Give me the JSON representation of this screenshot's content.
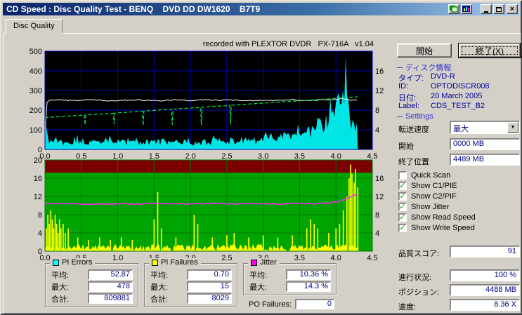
{
  "window": {
    "title": "CD Speed : Disc Quality Test - BENQ    DVD DD DW1620    B7T9"
  },
  "tab": {
    "label": "Disc Quality"
  },
  "chart_header": "recorded with PLEXTOR DVDR   PX-716A   v1.04",
  "chart_data": [
    {
      "id": "pi-errors-speed",
      "type": "area",
      "seed": 13,
      "bg": "#000000",
      "grid": "#0000BB",
      "x_range": [
        0,
        4.5
      ],
      "x_ticks": [
        "0.0",
        "0.5",
        "1.0",
        "1.5",
        "2.0",
        "2.5",
        "3.0",
        "3.5",
        "4.0",
        "4.5"
      ],
      "y_range": [
        0,
        500
      ],
      "left_ticks": [
        500,
        400,
        300,
        200,
        100,
        0
      ],
      "right_axis_range": [
        0,
        20
      ],
      "right_ticks": [
        16,
        12,
        8,
        4
      ],
      "grid_values": [
        100,
        200,
        300,
        400
      ],
      "series": [
        {
          "name": "PI Errors",
          "type": "noise-fill",
          "color": "#00E6E6",
          "x0": 0,
          "step": 0.05,
          "values": [
            170,
            60,
            45,
            70,
            50,
            40,
            55,
            45,
            60,
            50,
            45,
            55,
            40,
            50,
            45,
            55,
            40,
            45,
            50,
            40,
            45,
            50,
            40,
            45,
            40,
            50,
            45,
            40,
            45,
            40,
            50,
            45,
            40,
            45,
            40,
            45,
            40,
            45,
            40,
            45,
            40,
            45,
            50,
            40,
            45,
            40,
            45,
            50,
            45,
            40,
            45,
            50,
            45,
            50,
            55,
            50,
            55,
            60,
            55,
            60,
            65,
            60,
            70,
            65,
            75,
            70,
            80,
            85,
            90,
            85,
            95,
            100,
            110,
            105,
            120,
            130,
            140,
            160,
            200,
            260,
            360,
            478,
            430,
            300,
            190,
            140,
            120
          ]
        },
        {
          "name": "Read Speed",
          "type": "line",
          "color": "#FFFFFF",
          "noise": 2.5,
          "width": 1,
          "points": [
            [
              0,
              80
            ],
            [
              0.03,
              248
            ],
            [
              0.2,
              252
            ],
            [
              0.4,
              249
            ],
            [
              0.6,
              254
            ],
            [
              0.8,
              250
            ],
            [
              1,
              247
            ],
            [
              1.2,
              253
            ],
            [
              1.4,
              250
            ],
            [
              1.6,
              248
            ],
            [
              1.8,
              252
            ],
            [
              2,
              249
            ],
            [
              2.2,
              253
            ],
            [
              2.4,
              250
            ],
            [
              2.6,
              252
            ],
            [
              2.8,
              248
            ],
            [
              3,
              251
            ],
            [
              3.2,
              249
            ],
            [
              3.4,
              253
            ],
            [
              3.6,
              250
            ],
            [
              3.8,
              252
            ],
            [
              4,
              255
            ],
            [
              4.1,
              258
            ],
            [
              4.2,
              252
            ],
            [
              4.3,
              250
            ]
          ]
        },
        {
          "name": "Write Speed",
          "type": "dashed-line",
          "color": "#00DD44",
          "width": 1.3,
          "points": [
            [
              0,
              162
            ],
            [
              0.54,
              175
            ],
            [
              0.55,
              125
            ],
            [
              0.56,
              176
            ],
            [
              0.94,
              184
            ],
            [
              0.95,
              128
            ],
            [
              0.96,
              185
            ],
            [
              1.34,
              195
            ],
            [
              1.35,
              122
            ],
            [
              1.36,
              195
            ],
            [
              1.74,
              205
            ],
            [
              1.75,
              126
            ],
            [
              1.76,
              205
            ],
            [
              2.14,
              214
            ],
            [
              2.15,
              124
            ],
            [
              2.16,
              215
            ],
            [
              2.54,
              224
            ],
            [
              2.55,
              127
            ],
            [
              2.56,
              225
            ],
            [
              3,
              236
            ],
            [
              3.5,
              248
            ],
            [
              4,
              260
            ],
            [
              4.3,
              268
            ]
          ]
        }
      ]
    },
    {
      "id": "pif-jitter",
      "type": "spikes-line",
      "seed": 99,
      "bg": "#00A400",
      "grid": "#007800",
      "band": {
        "from": 17.2,
        "to": 20,
        "color": "#7A0000"
      },
      "x_range": [
        0,
        4.5
      ],
      "x_ticks": [
        "0.0",
        "0.5",
        "1.0",
        "1.5",
        "2.0",
        "2.5",
        "3.0",
        "3.5",
        "4.0",
        "4.5"
      ],
      "y_range": [
        0,
        20
      ],
      "left_ticks": [
        20,
        16,
        12,
        8,
        4,
        0
      ],
      "right_axis_range": [
        0,
        20
      ],
      "right_ticks": [
        16,
        12,
        8,
        4
      ],
      "grid_values": [
        4,
        8,
        12,
        16
      ],
      "series": [
        {
          "name": "PI Failures",
          "type": "spikes",
          "color": "#FFFF00",
          "baseline_max": 1.6,
          "max_x": 4.32,
          "spikes": [
            [
              0.02,
              5
            ],
            [
              0.04,
              8
            ],
            [
              0.06,
              6
            ],
            [
              0.08,
              9
            ],
            [
              0.1,
              7
            ],
            [
              0.12,
              5
            ],
            [
              0.14,
              8
            ],
            [
              0.16,
              6
            ],
            [
              0.18,
              4
            ],
            [
              0.2,
              7
            ],
            [
              0.22,
              5
            ],
            [
              0.25,
              6
            ],
            [
              0.28,
              4
            ],
            [
              0.32,
              5
            ],
            [
              0.45,
              3
            ],
            [
              0.6,
              2.5
            ],
            [
              0.75,
              3
            ],
            [
              0.9,
              2.5
            ],
            [
              1.05,
              3
            ],
            [
              1.2,
              2.5
            ],
            [
              1.5,
              7
            ],
            [
              1.55,
              13
            ],
            [
              1.6,
              5
            ],
            [
              1.8,
              3
            ],
            [
              2.05,
              8
            ],
            [
              2.1,
              6
            ],
            [
              2.3,
              3
            ],
            [
              2.5,
              3.5
            ],
            [
              2.6,
              4
            ],
            [
              2.8,
              3
            ],
            [
              3,
              3.5
            ],
            [
              3.2,
              3
            ],
            [
              3.4,
              3.5
            ],
            [
              3.6,
              5
            ],
            [
              3.65,
              7
            ],
            [
              3.7,
              6
            ],
            [
              3.75,
              5
            ],
            [
              3.9,
              4
            ],
            [
              4,
              5
            ],
            [
              4.05,
              6
            ],
            [
              4.1,
              9
            ],
            [
              4.15,
              12
            ],
            [
              4.18,
              16
            ],
            [
              4.2,
              19
            ],
            [
              4.22,
              17
            ],
            [
              4.25,
              15
            ],
            [
              4.27,
              18
            ],
            [
              4.3,
              14
            ]
          ]
        },
        {
          "name": "Jitter",
          "type": "noise-line",
          "color": "#FF22FF",
          "noise": 0.15,
          "width": 1.5,
          "points": [
            [
              0,
              10.6
            ],
            [
              0.1,
              10.4
            ],
            [
              0.3,
              10.5
            ],
            [
              0.5,
              10.3
            ],
            [
              0.7,
              10.4
            ],
            [
              0.9,
              10.3
            ],
            [
              1.1,
              10.4
            ],
            [
              1.3,
              10.3
            ],
            [
              1.5,
              10.5
            ],
            [
              1.7,
              10.4
            ],
            [
              1.9,
              10.3
            ],
            [
              2.1,
              10.4
            ],
            [
              2.3,
              10.5
            ],
            [
              2.5,
              10.4
            ],
            [
              2.7,
              10.3
            ],
            [
              2.9,
              10.4
            ],
            [
              3.1,
              10.3
            ],
            [
              3.3,
              10.4
            ],
            [
              3.5,
              10.5
            ],
            [
              3.7,
              10.4
            ],
            [
              3.9,
              10.5
            ],
            [
              4,
              10.8
            ],
            [
              4.1,
              11.2
            ],
            [
              4.2,
              11.8
            ],
            [
              4.25,
              12.2
            ],
            [
              4.3,
              12.4
            ]
          ]
        }
      ]
    }
  ],
  "stats": {
    "pi_errors": {
      "title": "PI Errors",
      "color": "#00FFFF",
      "rows": [
        {
          "label": "平均:",
          "value": "52.87"
        },
        {
          "label": "最大:",
          "value": "478"
        },
        {
          "label": "合計:",
          "value": "809881"
        }
      ]
    },
    "pi_failures": {
      "title": "PI Failures",
      "color": "#FFFF00",
      "rows": [
        {
          "label": "平均:",
          "value": "0.70"
        },
        {
          "label": "最大:",
          "value": "15"
        },
        {
          "label": "合計:",
          "value": "8029"
        }
      ]
    },
    "jitter": {
      "title": "Jitter",
      "color": "#FF00FF",
      "rows": [
        {
          "label": "平均:",
          "value": "10.36 %"
        },
        {
          "label": "最大:",
          "value": "14.3 %"
        }
      ]
    },
    "po_failures": {
      "label": "PO Failures:",
      "value": "0"
    }
  },
  "sidebar": {
    "start_button": "開始",
    "exit_button": "終了(X)",
    "disc_info": {
      "title": "ディスク情報",
      "rows": [
        {
          "label": "タイプ:",
          "value": "DVD-R"
        },
        {
          "label": "ID:",
          "value": "OPTODISCR008"
        },
        {
          "label": "日付:",
          "value": "20 March 2005"
        },
        {
          "label": "Label:",
          "value": "CDS_TEST_B2"
        }
      ]
    },
    "settings": {
      "title": "Settings",
      "transfer_label": "転送速度",
      "transfer_value": "最大",
      "start_label": "開始",
      "start_value": "0000 MB",
      "end_label": "終了位置",
      "end_value": "4489 MB",
      "checkboxes": [
        {
          "label": "Quick Scan",
          "checked": false
        },
        {
          "label": "Show C1/PIE",
          "checked": true
        },
        {
          "label": "Show C2/PIF",
          "checked": true
        },
        {
          "label": "Show Jitter",
          "checked": true
        },
        {
          "label": "Show Read Speed",
          "checked": true
        },
        {
          "label": "Show Write Speed",
          "checked": true
        }
      ]
    },
    "quality": {
      "label": "品質スコア:",
      "value": "91"
    },
    "progress": {
      "label": "進行状況:",
      "value": "100 %"
    },
    "position": {
      "label": "ポジション:",
      "value": "4488 MB"
    },
    "speed": {
      "label": "速度:",
      "value": "8.36 X"
    }
  }
}
